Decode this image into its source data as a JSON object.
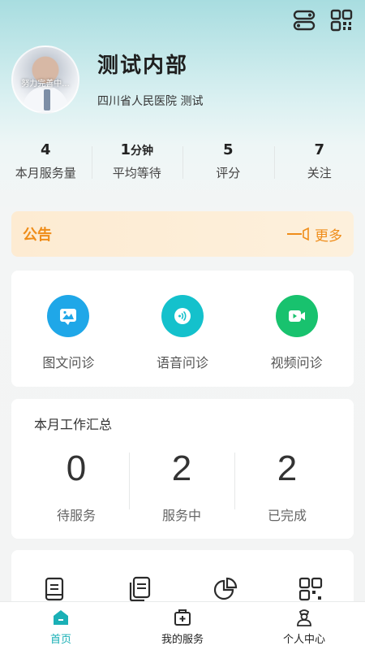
{
  "header": {
    "icons": [
      "toggle-icon",
      "qrcode-icon"
    ]
  },
  "profile": {
    "name": "测试内部",
    "hospital": "四川省人民医院 测试",
    "avatar_tip": "努力完善中..."
  },
  "stats": [
    {
      "value": "4",
      "unit": "",
      "label": "本月服务量"
    },
    {
      "value": "1",
      "unit": "分钟",
      "label": "平均等待"
    },
    {
      "value": "5",
      "unit": "",
      "label": "评分"
    },
    {
      "value": "7",
      "unit": "",
      "label": "关注"
    }
  ],
  "notice": {
    "title": "公告",
    "more_label": "更多",
    "color": "#ef8d1a"
  },
  "consult": [
    {
      "label": "图文问诊",
      "icon": "image-chat-icon",
      "color": "#1fa7e8"
    },
    {
      "label": "语音问诊",
      "icon": "voice-icon",
      "color": "#14c1cc"
    },
    {
      "label": "视频问诊",
      "icon": "video-icon",
      "color": "#18c26e"
    }
  ],
  "summary": {
    "title": "本月工作汇总",
    "items": [
      {
        "value": "0",
        "label": "待服务"
      },
      {
        "value": "2",
        "label": "服务中"
      },
      {
        "value": "2",
        "label": "已完成"
      }
    ]
  },
  "tools": [
    "document-icon",
    "documents-icon",
    "pie-chart-icon",
    "qrcode-icon"
  ],
  "tabbar": {
    "active_color": "#1ab0b6",
    "tabs": [
      {
        "label": "首页",
        "icon": "home-icon",
        "active": true
      },
      {
        "label": "我的服务",
        "icon": "medical-kit-icon",
        "active": false
      },
      {
        "label": "个人中心",
        "icon": "doctor-icon",
        "active": false
      }
    ]
  }
}
